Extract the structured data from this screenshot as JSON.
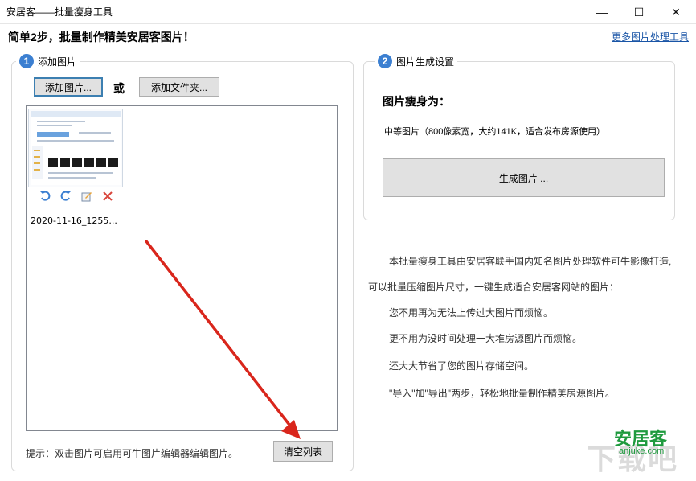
{
  "window": {
    "title": "安居客——批量瘦身工具",
    "minimize": "—",
    "maximize": "☐",
    "close": "✕"
  },
  "header": {
    "headline": "简单2步，批量制作精美安居客图片！",
    "more_link": "更多图片处理工具"
  },
  "step1": {
    "number": "1",
    "title": "添加图片",
    "add_button": "添加图片...",
    "or_text": "或",
    "add_folder_button": "添加文件夹...",
    "items": [
      {
        "name": "2020-11-16_1255...",
        "tools": [
          "rotate-left-icon",
          "rotate-right-icon",
          "edit-icon",
          "delete-icon"
        ]
      }
    ],
    "hint": "提示：双击图片可启用可牛图片编辑器编辑图片。",
    "clear_button": "清空列表"
  },
  "step2": {
    "number": "2",
    "title": "图片生成设置",
    "size_label": "图片瘦身为：",
    "size_option": "中等图片（800像素宽，大约141K，适合发布房源使用）",
    "generate_button": "生成图片 ..."
  },
  "description": [
    "本批量瘦身工具由安居客联手国内知名图片处理软件可牛影像打造,",
    "可以批量压缩图片尺寸，一键生成适合安居客网站的图片：",
    "您不用再为无法上传过大图片而烦恼。",
    "更不用为没时间处理一大堆房源图片而烦恼。",
    "还大大节省了您的图片存储空间。",
    "\"导入\"加\"导出\"两步，轻松地批量制作精美房源图片。"
  ],
  "logo": {
    "main": "安居客",
    "sub": "anjuke.com",
    "watermark": "下载吧"
  },
  "colors": {
    "accent": "#3b7fd1",
    "link": "#1a55a6",
    "arrow": "#d9261c",
    "logo_green": "#1f9a3e"
  }
}
